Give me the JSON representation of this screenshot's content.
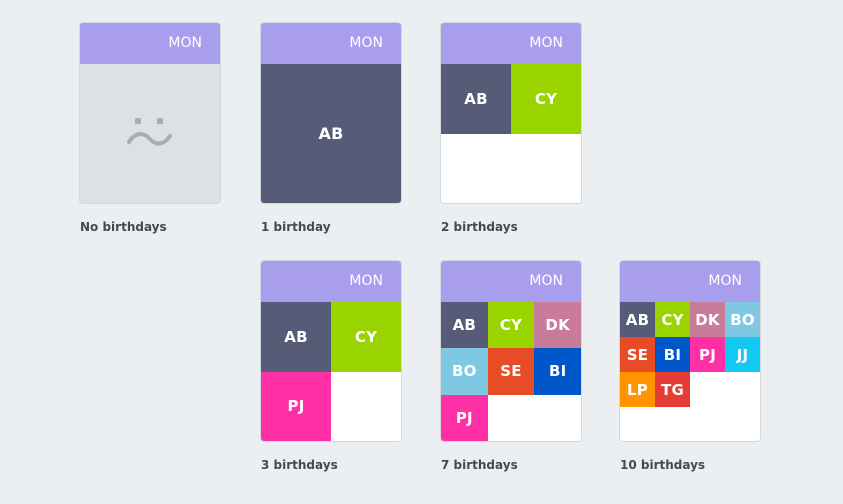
{
  "day_label": "MON",
  "colors": {
    "header": "#a99eed",
    "empty_bg": "#dde1e4",
    "AB": "#565b78",
    "CY": "#9ad400",
    "DK": "#c97c9a",
    "BO": "#7ec8e1",
    "SE": "#e84c26",
    "BI": "#0057c9",
    "PJ": "#ff2fa6",
    "JJ": "#12c9f2",
    "LP": "#ff9300",
    "TG": "#e53d36"
  },
  "cards": [
    {
      "caption": "No birthdays",
      "people": [],
      "empty_icon": "sad-face-icon"
    },
    {
      "caption": "1 birthday",
      "people": [
        "AB"
      ]
    },
    {
      "caption": "2 birthdays",
      "people": [
        "AB",
        "CY"
      ]
    },
    {
      "caption": "3 birthdays",
      "people": [
        "AB",
        "CY",
        "PJ"
      ]
    },
    {
      "caption": "7 birthdays",
      "people": [
        "AB",
        "CY",
        "DK",
        "BO",
        "SE",
        "BI",
        "PJ"
      ]
    },
    {
      "caption": "10 birthdays",
      "people": [
        "AB",
        "CY",
        "DK",
        "BO",
        "SE",
        "BI",
        "PJ",
        "JJ",
        "LP",
        "TG"
      ]
    }
  ]
}
